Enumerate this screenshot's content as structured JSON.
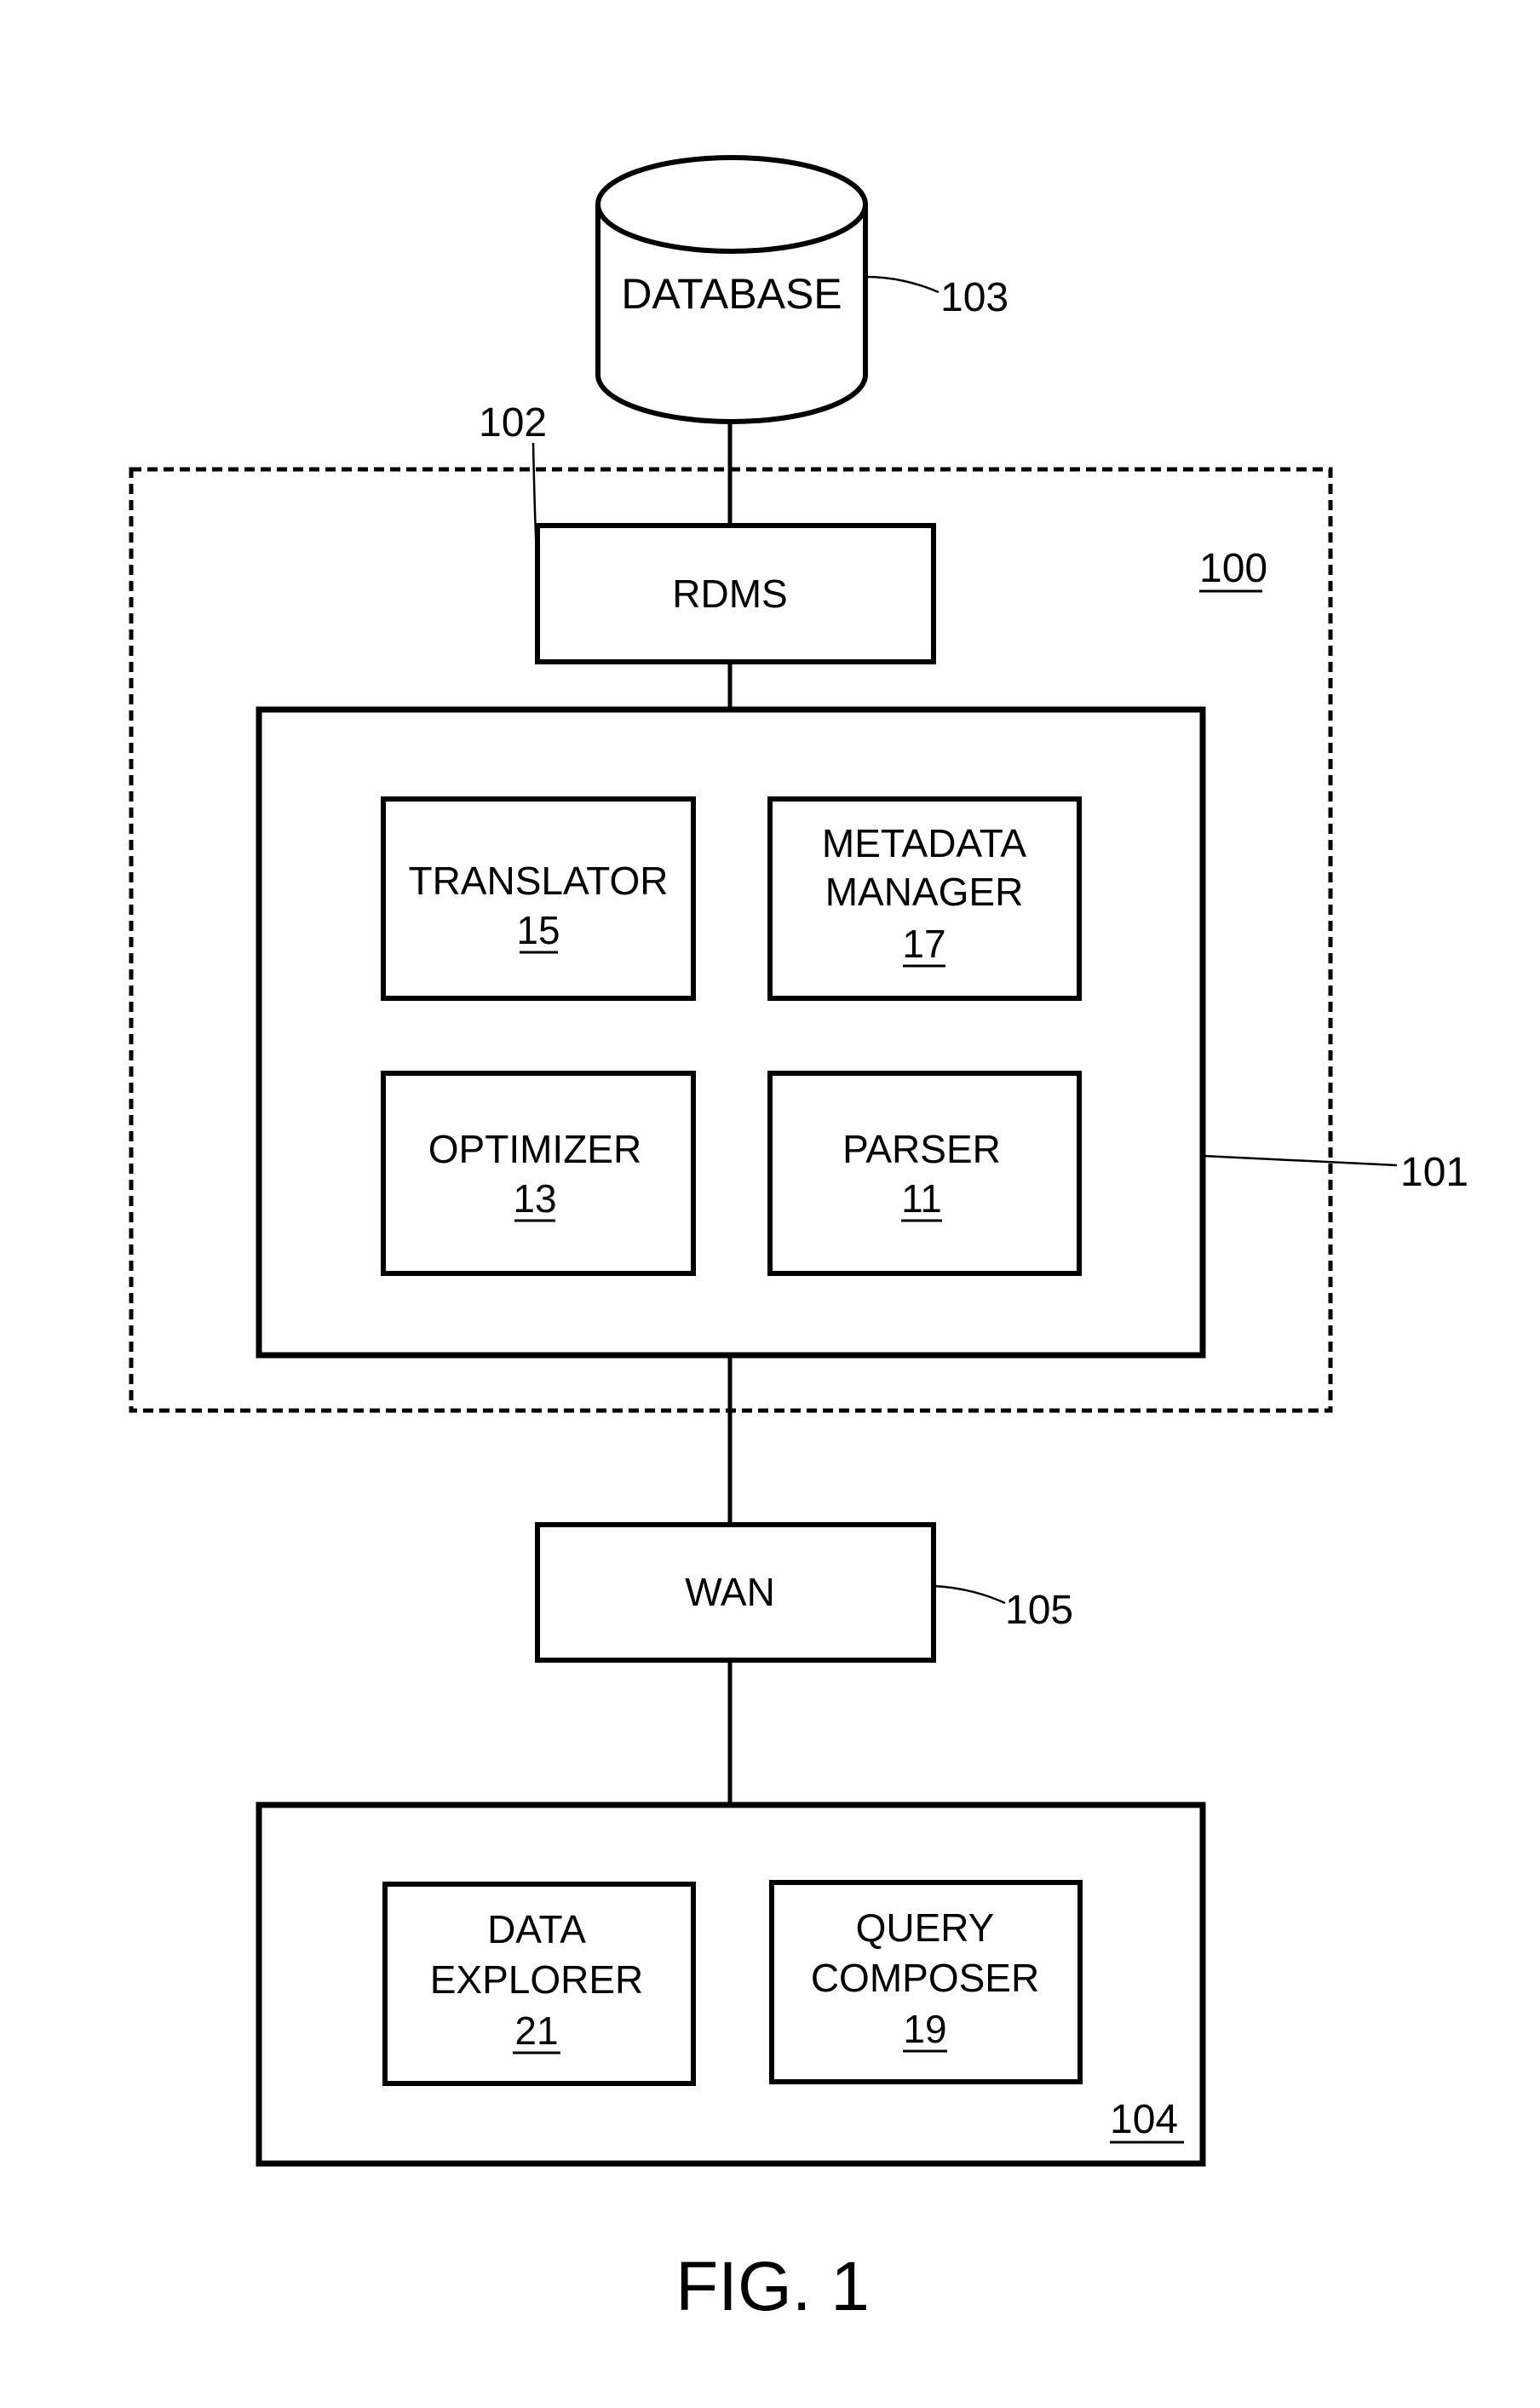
{
  "figure": {
    "caption": "FIG. 1",
    "database": {
      "label": "DATABASE",
      "ref": "103"
    },
    "system": {
      "ref": "100"
    },
    "rdms": {
      "label": "RDMS",
      "ref": "102"
    },
    "server": {
      "ref": "101",
      "modules": [
        {
          "line1": "TRANSLATOR",
          "line2": "",
          "ref": "15"
        },
        {
          "line1": "METADATA",
          "line2": "MANAGER",
          "ref": "17"
        },
        {
          "line1": "OPTIMIZER",
          "line2": "",
          "ref": "13"
        },
        {
          "line1": "PARSER",
          "line2": "",
          "ref": "11"
        }
      ]
    },
    "wan": {
      "label": "WAN",
      "ref": "105"
    },
    "client": {
      "ref": "104",
      "modules": [
        {
          "line1": "DATA",
          "line2": "EXPLORER",
          "ref": "21"
        },
        {
          "line1": "QUERY",
          "line2": "COMPOSER",
          "ref": "19"
        }
      ]
    }
  }
}
